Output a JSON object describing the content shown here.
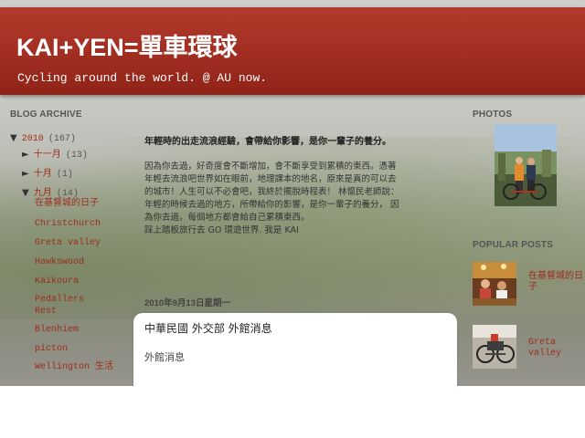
{
  "header": {
    "title": "KAI+YEN=單車環球",
    "description": "Cycling around the world. @ AU now."
  },
  "sidebar": {
    "archive_title": "BLOG ARCHIVE",
    "year": {
      "toggle": "▼",
      "label": "2010",
      "count": "(167)"
    },
    "months": [
      {
        "toggle": "►",
        "label": "十一月",
        "count": "(13)"
      },
      {
        "toggle": "►",
        "label": "十月",
        "count": "(1)"
      },
      {
        "toggle": "▼",
        "label": "九月",
        "count": "(14)"
      }
    ],
    "posts": [
      {
        "label": "在基督城的日子"
      },
      {
        "label": "Christchurch"
      },
      {
        "label": "Greta valley"
      },
      {
        "label": "Hawkswood"
      },
      {
        "label": "Kaikoura"
      },
      {
        "label": "Pedallers Rest"
      },
      {
        "label": "Blenhiem"
      },
      {
        "label": "picton"
      },
      {
        "label": "Wellington 生活"
      }
    ]
  },
  "main": {
    "intro_title": "年輕時的出走流浪經驗，會帶給你影響，是你一輩子的養分。",
    "intro_lines": [
      "因為你去過，好奇度會不斷增加，會不斷享受到累積的東西。憑著",
      "年輕去流浪吧世界如在眼前，地理課本的地名，原來是真的可以去",
      "的城市！人生可以不必會吧，我終於擺脫時程表！ 林懷民老師說：",
      "年輕的時候去過的地方，所帶給你的影響，是你一輩子的養分， 因",
      "為你去過，每個地方都會給自己累積東西。",
      "踩上踏板旅行去 GO 環遊世界. 我是 KAI"
    ],
    "date_header": "2010年9月13日星期一",
    "post": {
      "title": "中華民國 外交部 外館消息",
      "body": "外館消息"
    }
  },
  "right": {
    "photos_title": "PHOTOS",
    "popular_title": "POPULAR POSTS",
    "popular": [
      {
        "label": "在基督城的日子"
      },
      {
        "label": "Greta valley"
      }
    ]
  },
  "colors": {
    "header_red": "#a3301f",
    "link_red": "#9e2b1e"
  }
}
